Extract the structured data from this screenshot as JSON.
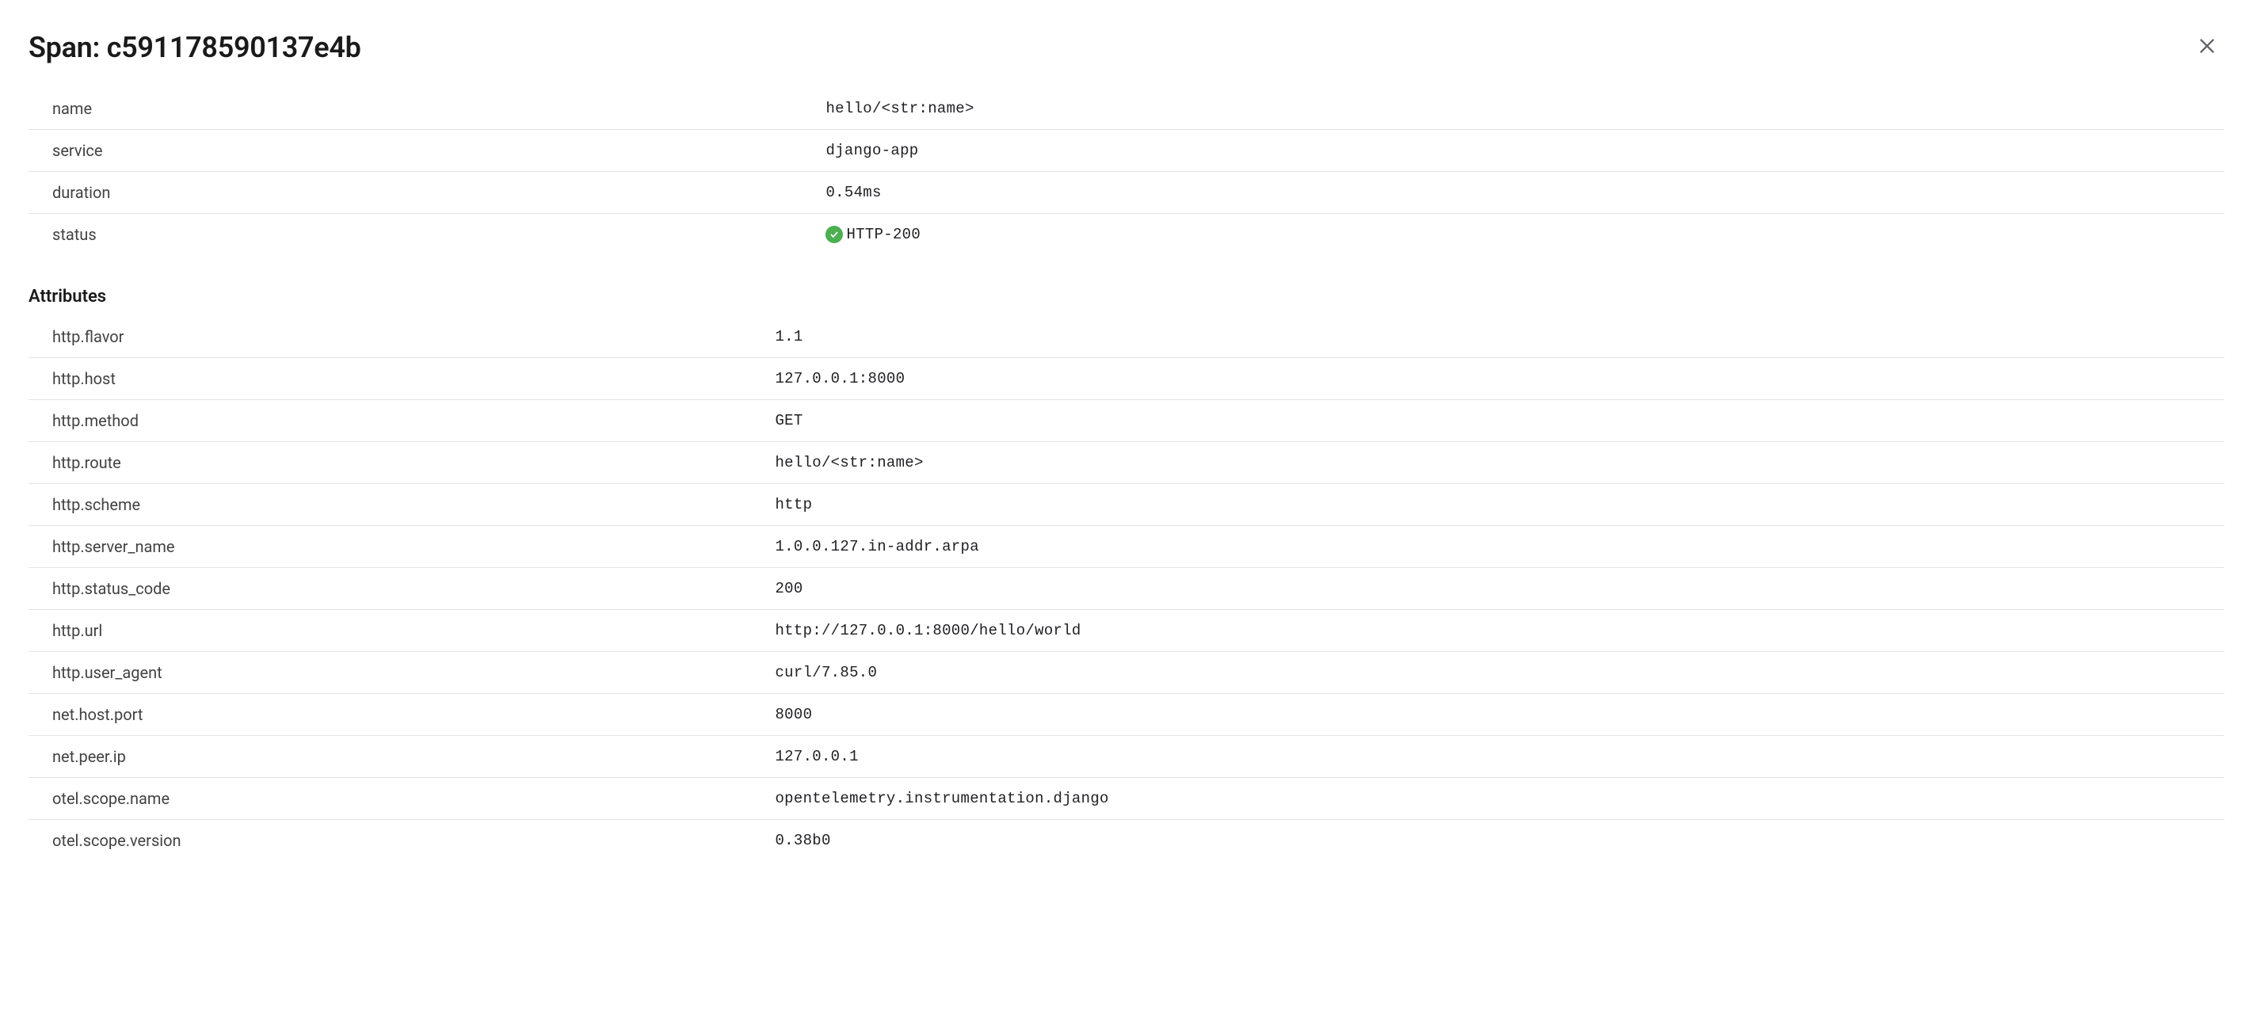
{
  "header": {
    "title_prefix": "Span: ",
    "span_id": "c591178590137e4b"
  },
  "overview": [
    {
      "key": "name",
      "value": "hello/<str:name>"
    },
    {
      "key": "service",
      "value": "django-app"
    },
    {
      "key": "duration",
      "value": "0.54ms"
    },
    {
      "key": "status",
      "value": "HTTP-200",
      "status_ok": true
    }
  ],
  "attributes_heading": "Attributes",
  "attributes": [
    {
      "key": "http.flavor",
      "value": "1.1"
    },
    {
      "key": "http.host",
      "value": "127.0.0.1:8000"
    },
    {
      "key": "http.method",
      "value": "GET"
    },
    {
      "key": "http.route",
      "value": "hello/<str:name>"
    },
    {
      "key": "http.scheme",
      "value": "http"
    },
    {
      "key": "http.server_name",
      "value": "1.0.0.127.in-addr.arpa"
    },
    {
      "key": "http.status_code",
      "value": "200"
    },
    {
      "key": "http.url",
      "value": "http://127.0.0.1:8000/hello/world"
    },
    {
      "key": "http.user_agent",
      "value": "curl/7.85.0"
    },
    {
      "key": "net.host.port",
      "value": "8000"
    },
    {
      "key": "net.peer.ip",
      "value": "127.0.0.1"
    },
    {
      "key": "otel.scope.name",
      "value": "opentelemetry.instrumentation.django"
    },
    {
      "key": "otel.scope.version",
      "value": "0.38b0"
    }
  ]
}
